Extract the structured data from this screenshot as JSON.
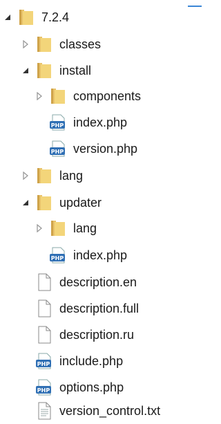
{
  "tree": {
    "root": {
      "label": "7.2.4"
    },
    "items": [
      {
        "label": "classes"
      },
      {
        "label": "install"
      },
      {
        "label": "components"
      },
      {
        "label": "index.php"
      },
      {
        "label": "version.php"
      },
      {
        "label": "lang"
      },
      {
        "label": "updater"
      },
      {
        "label": "lang"
      },
      {
        "label": "index.php"
      },
      {
        "label": "description.en"
      },
      {
        "label": "description.full"
      },
      {
        "label": "description.ru"
      },
      {
        "label": "include.php"
      },
      {
        "label": "options.php"
      },
      {
        "label": "version_control.txt"
      }
    ]
  }
}
